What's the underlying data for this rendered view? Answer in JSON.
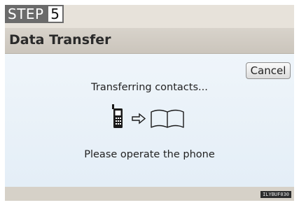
{
  "step": {
    "word": "STEP",
    "number": "5"
  },
  "window": {
    "title": "Data Transfer"
  },
  "buttons": {
    "cancel": "Cancel"
  },
  "messages": {
    "progress": "Transferring contacts...",
    "instruction": "Please operate the phone"
  },
  "icons": {
    "source": "phone-icon",
    "direction": "right-arrow-icon",
    "destination": "open-book-icon"
  },
  "figure_code": "ILYBUF030"
}
